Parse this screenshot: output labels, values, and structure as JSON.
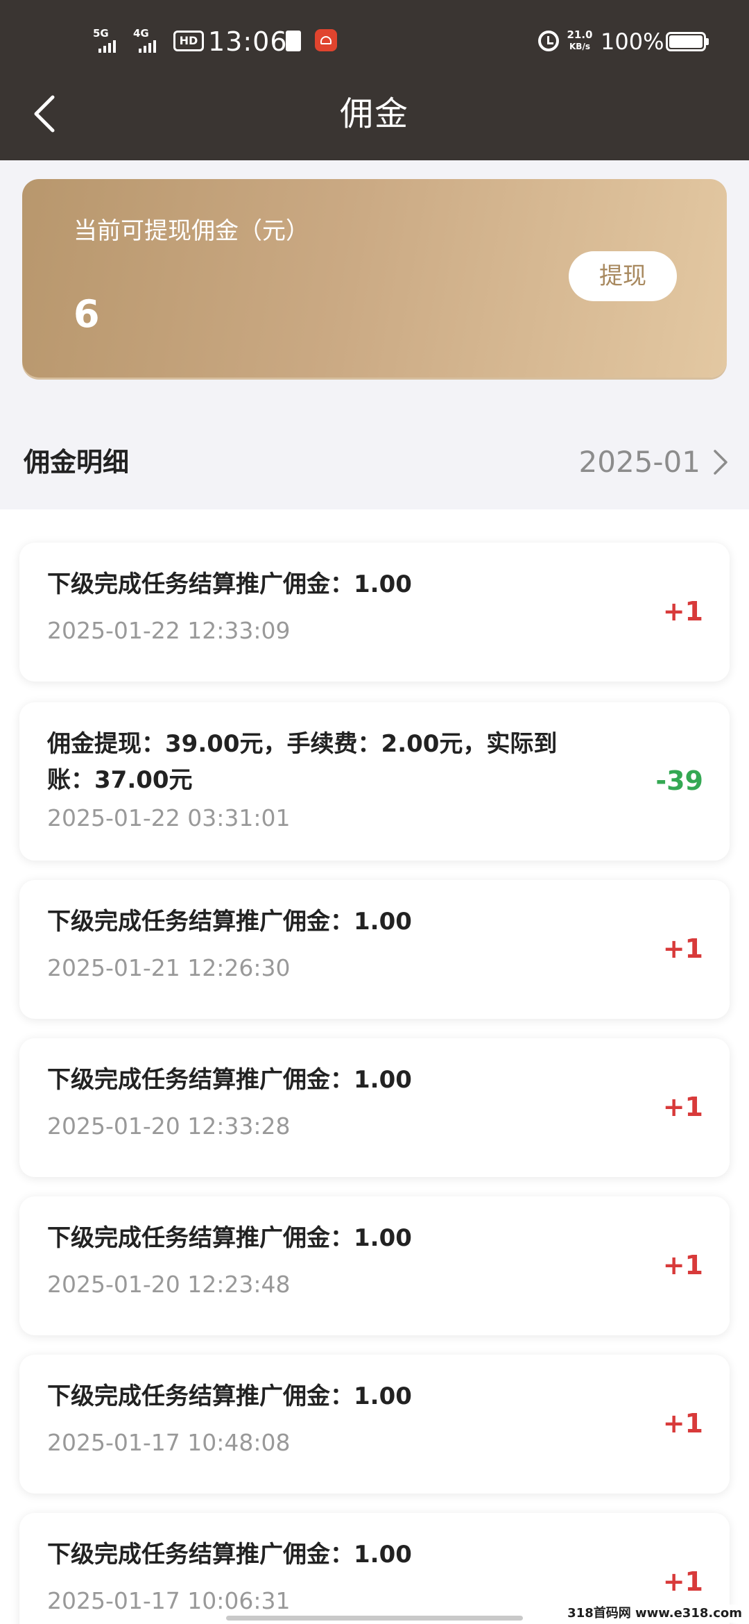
{
  "status_bar": {
    "sim1": "5G",
    "sim2": "4G",
    "hd": "HD",
    "time": "13:06",
    "net_speed_value": "21.0",
    "net_speed_unit": "KB/s",
    "battery": "100%"
  },
  "nav": {
    "title": "佣金"
  },
  "balance": {
    "label": "当前可提现佣金（元）",
    "value": "6",
    "withdraw_label": "提现"
  },
  "detail": {
    "title": "佣金明细",
    "month": "2025-01"
  },
  "records": [
    {
      "desc": "下级完成任务结算推广佣金：1.00",
      "time": "2025-01-22 12:33:09",
      "amount": "+1",
      "type": "income"
    },
    {
      "desc": "佣金提现：39.00元，手续费：2.00元，实际到账：37.00元",
      "time": "2025-01-22 03:31:01",
      "amount": "-39",
      "type": "expense"
    },
    {
      "desc": "下级完成任务结算推广佣金：1.00",
      "time": "2025-01-21 12:26:30",
      "amount": "+1",
      "type": "income"
    },
    {
      "desc": "下级完成任务结算推广佣金：1.00",
      "time": "2025-01-20 12:33:28",
      "amount": "+1",
      "type": "income"
    },
    {
      "desc": "下级完成任务结算推广佣金：1.00",
      "time": "2025-01-20 12:23:48",
      "amount": "+1",
      "type": "income"
    },
    {
      "desc": "下级完成任务结算推广佣金：1.00",
      "time": "2025-01-17 10:48:08",
      "amount": "+1",
      "type": "income"
    },
    {
      "desc": "下级完成任务结算推广佣金：1.00",
      "time": "2025-01-17 10:06:31",
      "amount": "+1",
      "type": "income"
    }
  ],
  "watermark": "318首码网 www.e318.com"
}
